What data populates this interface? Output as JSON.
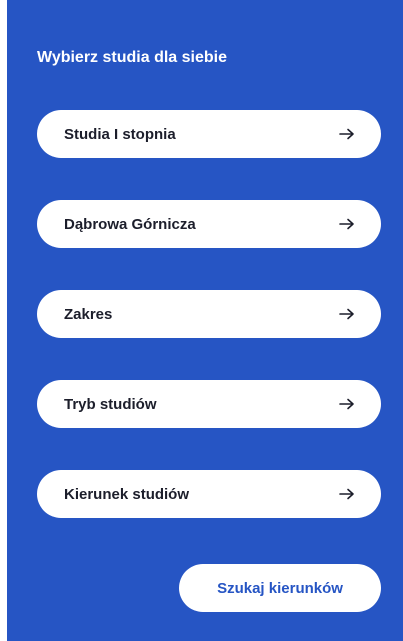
{
  "title": "Wybierz studia dla siebie",
  "filters": [
    {
      "label": "Studia I stopnia",
      "icon": "arrow-right-icon"
    },
    {
      "label": "Dąbrowa Górnicza",
      "icon": "arrow-right-icon"
    },
    {
      "label": "Zakres",
      "icon": "arrow-right-icon"
    },
    {
      "label": "Tryb studiów",
      "icon": "arrow-right-icon"
    },
    {
      "label": "Kierunek studiów",
      "icon": "arrow-right-icon"
    }
  ],
  "search_button": {
    "label": "Szukaj kierunków"
  },
  "colors": {
    "panel_background": "#2655c4",
    "button_background": "#ffffff",
    "button_text": "#1c1e2b",
    "search_text": "#2655c4"
  }
}
